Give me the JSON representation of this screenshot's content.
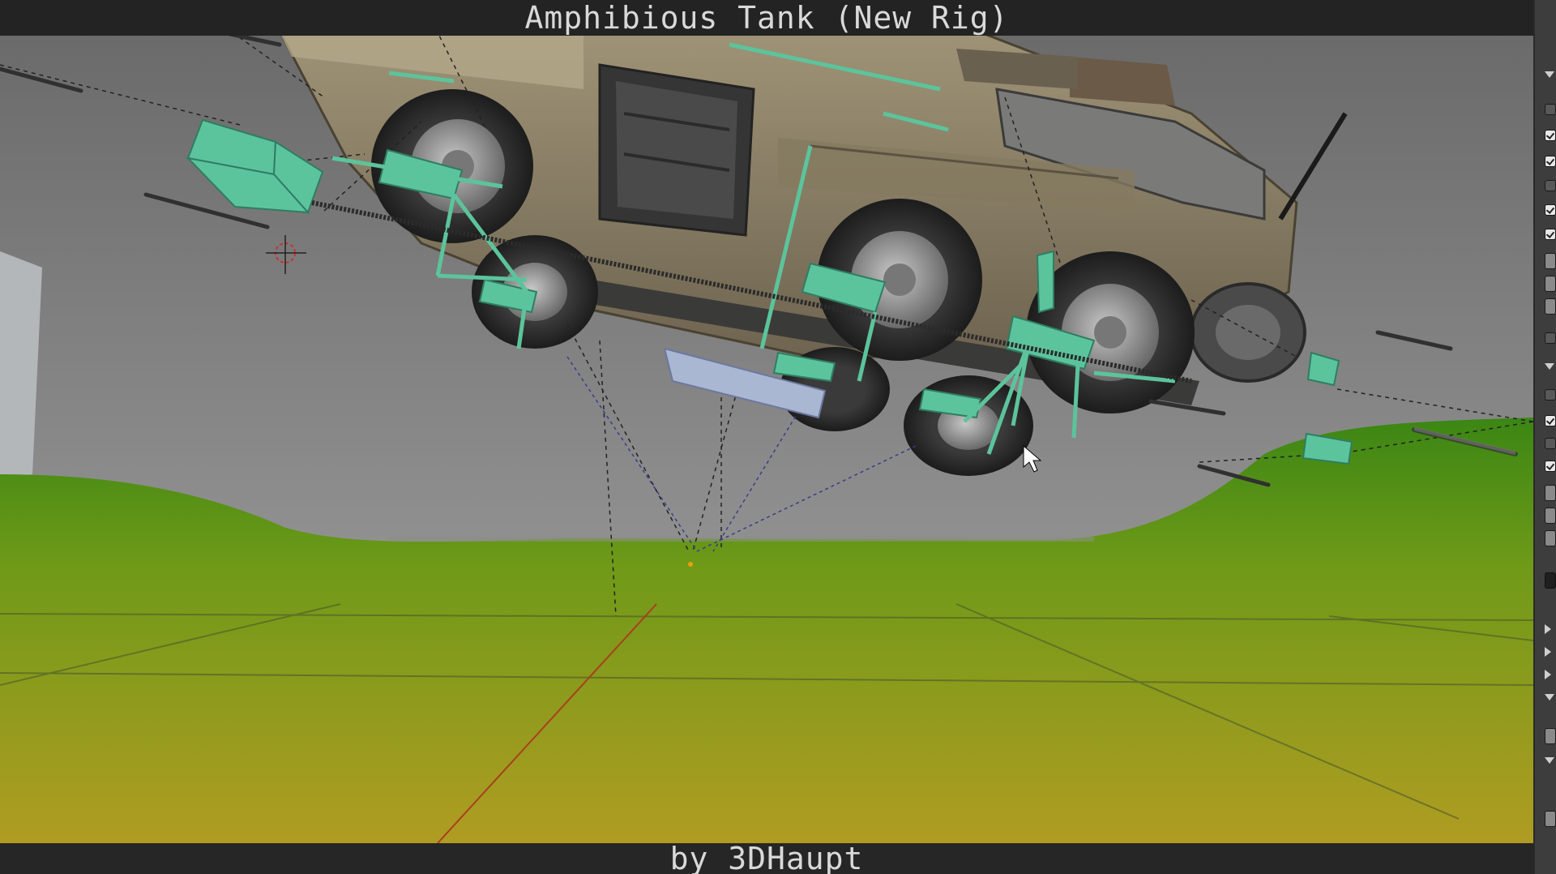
{
  "window": {
    "title": "Amphibious Tank (New Rig)",
    "credit": "by 3DHaupt"
  },
  "viewport": {
    "sky_color_top": "#6e6e6e",
    "sky_color_bottom": "#a8a8a8",
    "ground_color_top": "#3f8a12",
    "ground_color_bottom": "#a89a22",
    "rig_control_color": "#5fc4a0",
    "vehicle_color": "#8a7d62"
  },
  "side_panel": {
    "controls": [
      {
        "type": "tri"
      },
      {
        "type": "empty"
      },
      {
        "type": "checkbox"
      },
      {
        "type": "checkbox"
      },
      {
        "type": "empty"
      },
      {
        "type": "checkbox"
      },
      {
        "type": "checkbox"
      },
      {
        "type": "field"
      },
      {
        "type": "field"
      },
      {
        "type": "field"
      },
      {
        "type": "empty"
      },
      {
        "type": "tri"
      },
      {
        "type": "empty"
      },
      {
        "type": "checkbox"
      },
      {
        "type": "empty"
      },
      {
        "type": "checkbox"
      },
      {
        "type": "field"
      },
      {
        "type": "field"
      },
      {
        "type": "field"
      },
      {
        "type": "dark"
      },
      {
        "type": "tri-right"
      },
      {
        "type": "tri-right"
      },
      {
        "type": "tri-right"
      },
      {
        "type": "tri"
      },
      {
        "type": "field"
      },
      {
        "type": "tri"
      },
      {
        "type": "field"
      }
    ]
  }
}
